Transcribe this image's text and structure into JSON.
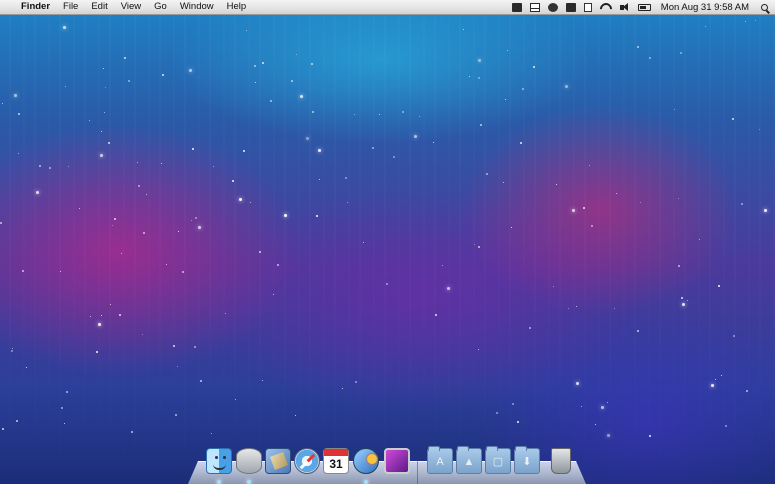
{
  "menubar": {
    "apple_glyph": "",
    "app_name": "Finder",
    "menus": [
      "File",
      "Edit",
      "View",
      "Go",
      "Window",
      "Help"
    ],
    "clock": "Mon Aug 31  9:58 AM"
  },
  "dock": {
    "calendar_day": "31",
    "stack_glyphs": [
      "A",
      "▲",
      "▢",
      "⬇"
    ]
  }
}
